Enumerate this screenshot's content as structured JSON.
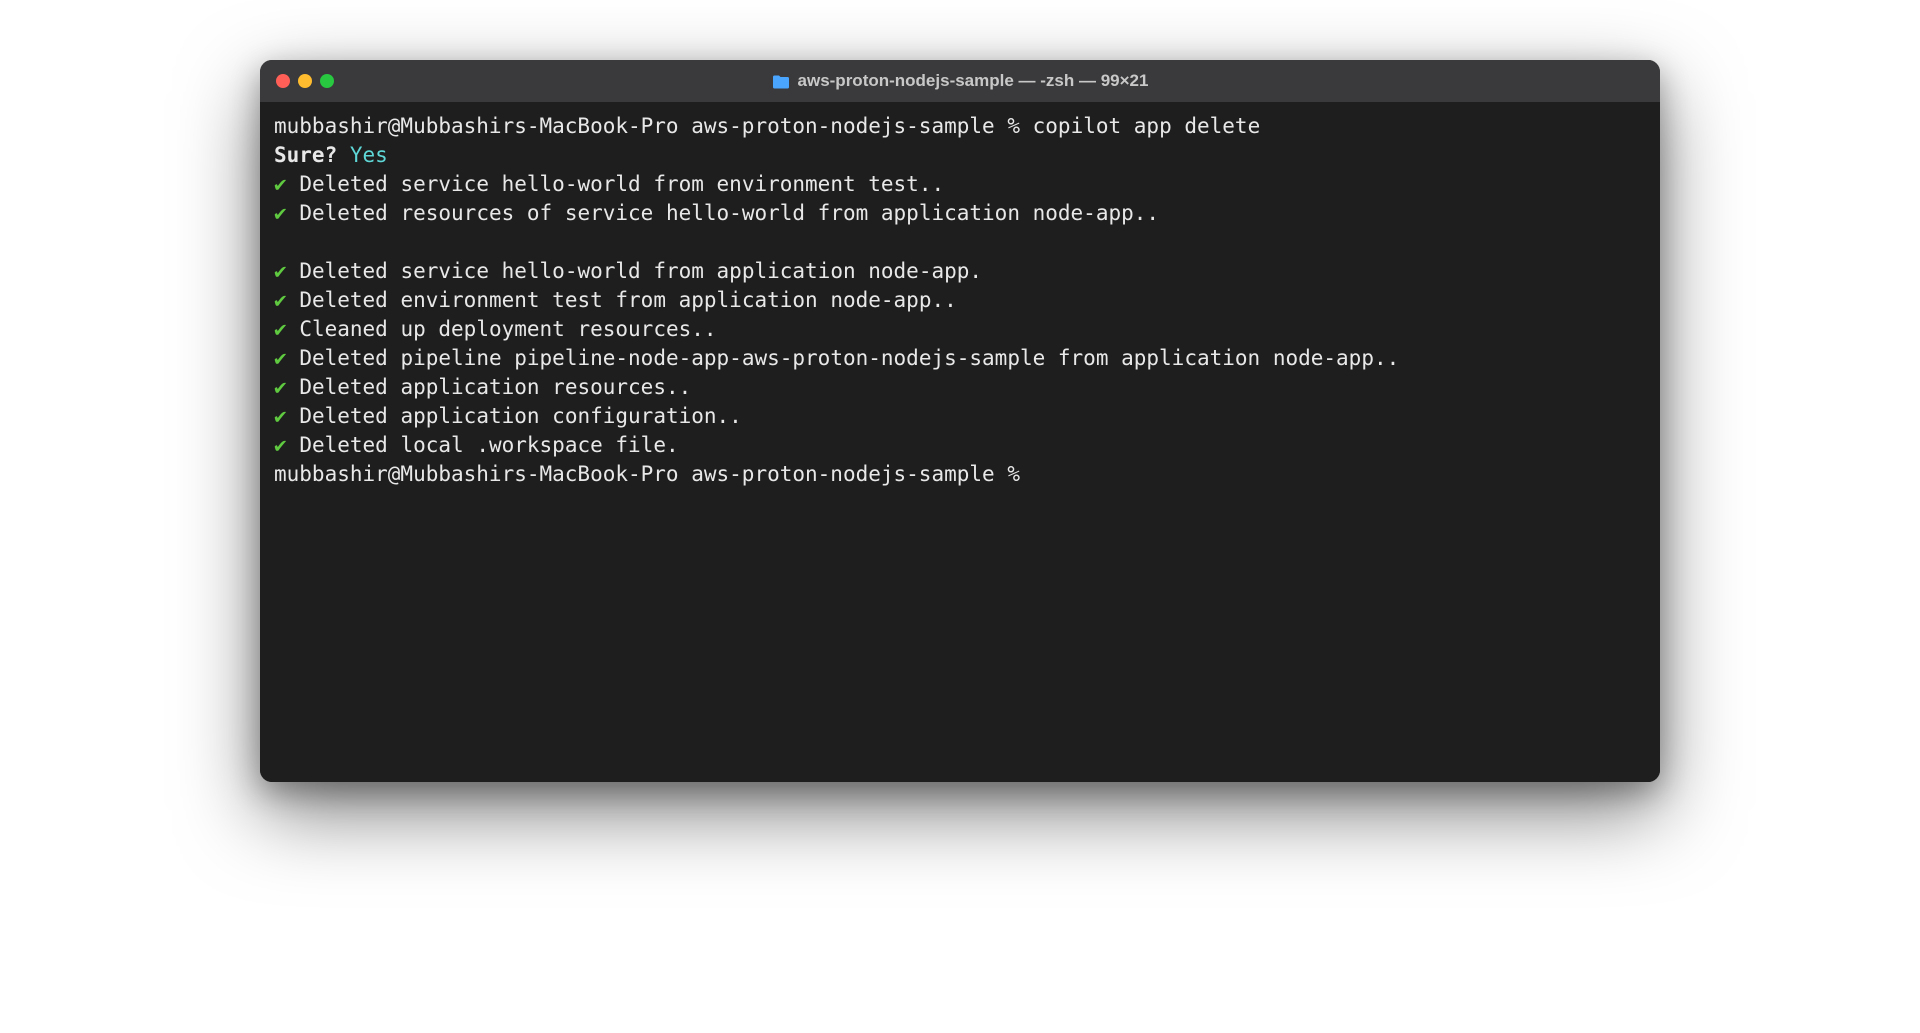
{
  "window": {
    "title": "aws-proton-nodejs-sample — -zsh — 99×21"
  },
  "terminal": {
    "prompt1_user_host": "mubbashir@Mubbashirs-MacBook-Pro",
    "prompt1_dir": "aws-proton-nodejs-sample",
    "prompt1_symbol": "%",
    "command": "copilot app delete",
    "confirm_question": "Sure?",
    "confirm_answer": "Yes",
    "check_mark": "✔",
    "lines": [
      "Deleted service hello-world from environment test..",
      "Deleted resources of service hello-world from application node-app..",
      "Deleted service hello-world from application node-app.",
      "Deleted environment test from application node-app..",
      "Cleaned up deployment resources..",
      "Deleted pipeline pipeline-node-app-aws-proton-nodejs-sample from application node-app..",
      "Deleted application resources..",
      "Deleted application configuration..",
      "Deleted local .workspace file."
    ],
    "prompt2_user_host": "mubbashir@Mubbashirs-MacBook-Pro",
    "prompt2_dir": "aws-proton-nodejs-sample",
    "prompt2_symbol": "%"
  }
}
